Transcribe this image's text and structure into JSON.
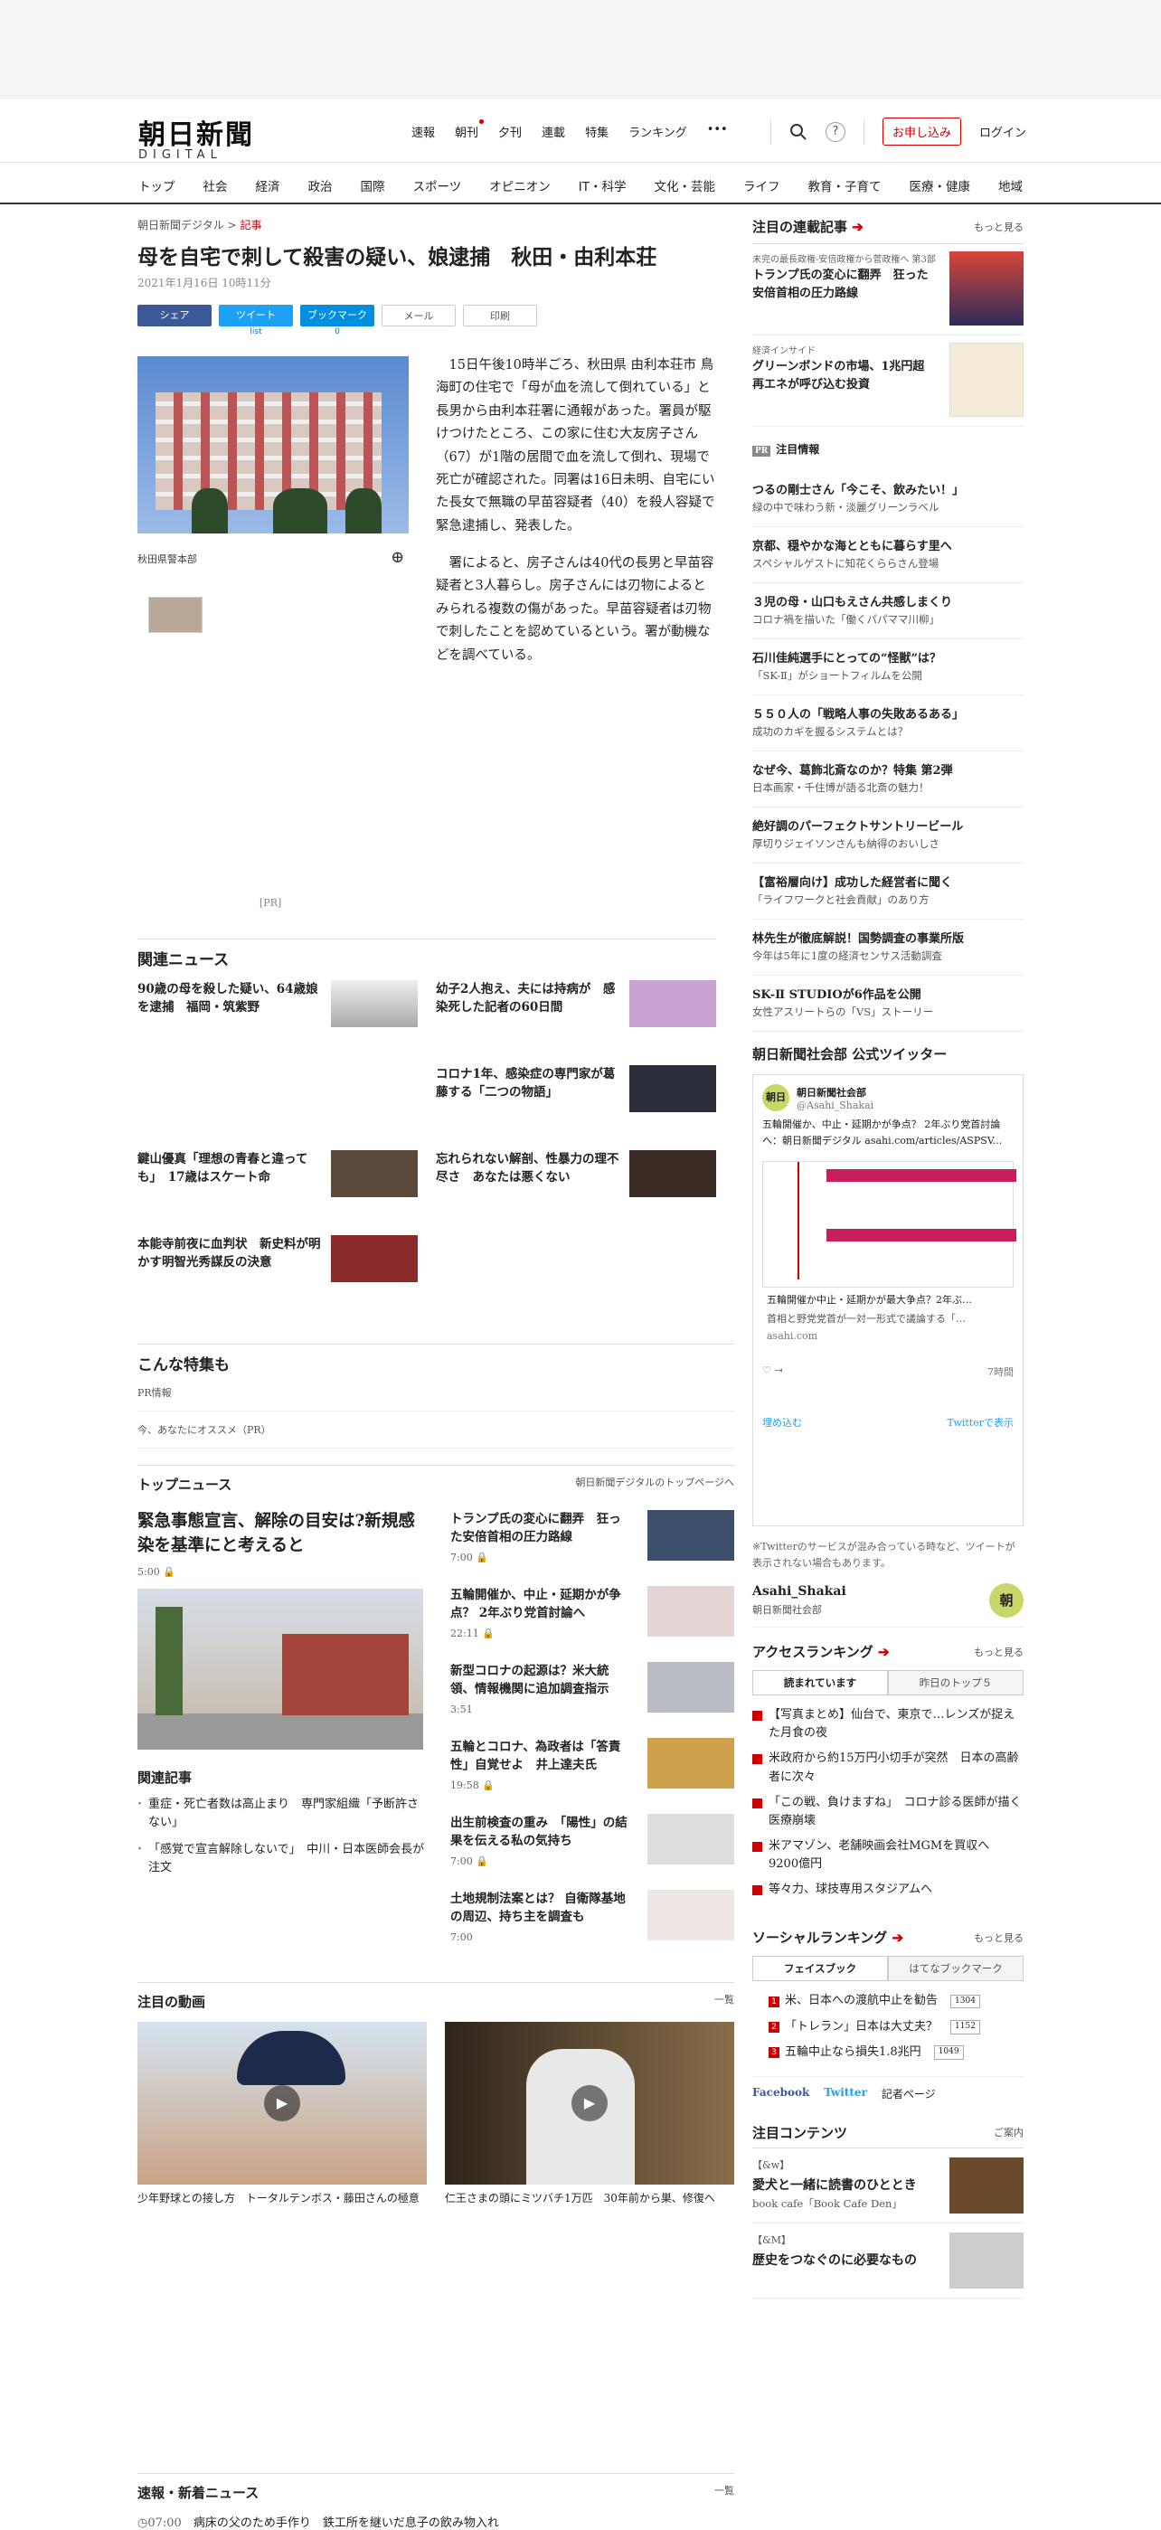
{
  "header": {
    "logo_ja": "朝日新聞",
    "logo_en": "DIGITAL",
    "nav": [
      "速報",
      "朝刊",
      "夕刊",
      "連載",
      "特集",
      "ランキング",
      "•••"
    ],
    "subscribe": "お申し込み",
    "login": "ログイン"
  },
  "gnav": [
    "トップ",
    "社会",
    "経済",
    "政治",
    "国際",
    "スポーツ",
    "オピニオン",
    "IT・科学",
    "文化・芸能",
    "ライフ",
    "教育・子育て",
    "医療・健康",
    "地域"
  ],
  "article": {
    "crumb_site": "朝日新聞デジタル",
    "crumb_sep": ">",
    "crumb_cat": "記事",
    "title": "母を自宅で刺して殺害の疑い、娘逮捕　秋田・由利本荘",
    "date": "2021年1月16日 10時11分",
    "share": {
      "fb": "シェア",
      "tw": "ツイート",
      "hb": "ブックマーク",
      "mail": "メール",
      "print": "印刷",
      "tw_count": "list",
      "hb_count": "0"
    },
    "caption": "秋田県警本部",
    "p1": "15日午後10時半ごろ、秋田県 由利本荘市 鳥海町の住宅で「母が血を流して倒れている」と長男から由利本荘署に通報があった。署員が駆けつけたところ、この家に住む大友房子さん（67）が1階の居間で血を流して倒れ、現場で死亡が確認された。同署は16日未明、自宅にいた長女で無職の早苗容疑者（40）を殺人容疑で緊急逮捕し、発表した。",
    "p2": "署によると、房子さんは40代の長男と早苗容疑者と3人暮らし。房子さんには刃物によるとみられる複数の傷があった。早苗容疑者は刃物で刺したことを認めているという。署が動機などを調べている。",
    "pr": "[PR]"
  },
  "related": {
    "title": "関連ニュース",
    "items": [
      "90歳の母を殺した疑い、64歳娘を逮捕　福岡・筑紫野",
      "幼子2人抱え、夫には持病が　感染死した記者の60日間",
      "",
      "コロナ1年、感染症の専門家が葛藤する「二つの物語」",
      "鍵山優真「理想の青春と違っても」　17歳はスケート命",
      "忘れられない解剖、性暴力の理不尽さ　あなたは悪くない",
      "本能寺前夜に血判状　新史料が明かす明智光秀謀反の決意",
      ""
    ]
  },
  "special": {
    "title": "こんな特集も",
    "rows": [
      "PR情報",
      "今、あなたにオススメ（PR）"
    ]
  },
  "topnews": {
    "title": "トップニュース",
    "more": "朝日新聞デジタルのトップページへ",
    "lead_title": "緊急事態宣言、解除の目安は?新規感染を基準にと考えると",
    "lead_time": "5:00",
    "related_title": "関連記事",
    "related": [
      "重症・死亡者数は高止まり　専門家組織「予断許さない」",
      "「感覚で宣言解除しないで」　中川・日本医師会長が注文"
    ],
    "items": [
      {
        "t": "トランプ氏の変心に翻弄　狂った安倍首相の圧力路線",
        "tm": "7:00"
      },
      {
        "t": "五輪開催か、中止・延期かが争点？ 2年ぶり党首討論へ",
        "tm": "22:11"
      },
      {
        "t": "新型コロナの起源は？米大統領、情報機関に追加調査指示",
        "tm": "3:51"
      },
      {
        "t": "五輪とコロナ、為政者は「答責性」自覚せよ　井上達夫氏",
        "tm": "19:58"
      },
      {
        "t": "出生前検査の重み　「陽性」の結果を伝える私の気持ち",
        "tm": "7:00"
      },
      {
        "t": "土地規制法案とは？ 自衛隊基地の周辺、持ち主を調査も",
        "tm": "7:00"
      }
    ]
  },
  "videos": {
    "title": "注目の動画",
    "more": "一覧",
    "items": [
      "少年野球との接し方　トータルテンボス・藤田さんの極意",
      "仁王さまの頭にミツバチ1万匹　30年前から巣、修復へ"
    ]
  },
  "flash": {
    "title": "速報・新着ニュース",
    "more": "一覧",
    "time": "07:00",
    "text": "病床の父のため手作り　鉄工所を継いだ息子の飲み物入れ"
  },
  "side": {
    "rensai_title": "注目の連載記事",
    "more": "もっと見る",
    "feat": [
      {
        "k": "未完の最長政権-安倍政権から菅政権へ 第3部",
        "t": "トランプ氏の変心に翻弄　狂った安倍首相の圧力路線"
      },
      {
        "k": "経済インサイド",
        "t": "グリーンボンドの市場、1兆円超　再エネが呼び込む投資"
      }
    ],
    "pr_label": "PR",
    "pr_title": "注目情報",
    "pr": [
      {
        "a": "つるの剛士さん「今こそ、飲みたい！」",
        "b": "緑の中で味わう新・淡麗グリーンラベル"
      },
      {
        "a": "京都、穏やかな海とともに暮らす里へ",
        "b": "スペシャルゲストに知花くららさん登場"
      },
      {
        "a": "３児の母・山口もえさん共感しまくり",
        "b": "コロナ禍を描いた「働くパパママ川柳」"
      },
      {
        "a": "石川佳純選手にとっての“怪獣”は？",
        "b": "「SK-Ⅱ」がショートフィルムを公開"
      },
      {
        "a": "５５０人の「戦略人事の失敗あるある」",
        "b": "成功のカギを握るシステムとは？"
      },
      {
        "a": "なぜ今、葛飾北斎なのか？特集 第2弾",
        "b": "日本画家・千住博が語る北斎の魅力！"
      },
      {
        "a": "絶好調のパーフェクトサントリービール",
        "b": "厚切りジェイソンさんも納得のおいしさ"
      },
      {
        "a": "【富裕層向け】成功した経営者に聞く",
        "b": "「ライフワークと社会貢献」のあり方"
      },
      {
        "a": "林先生が徹底解説！国勢調査の事業所版",
        "b": "今年は5年に1度の経済センサス活動調査"
      },
      {
        "a": "SK-Ⅱ STUDIOが6作品を公開",
        "b": "女性アスリートらの「VS」ストーリー"
      }
    ],
    "tw_title": "朝日新聞社会部 公式ツイッター",
    "tw": {
      "name": "朝日新聞社会部",
      "id": "@Asahi_Shakai",
      "text": "五輪開催か、中止・延期かが争点？ 2年ぶり党首討論へ：朝日新聞デジタル asahi.com/articles/ASPSV...",
      "card": "五輪開催か中止・延期かが最大争点？2年ぶ…",
      "card2": "首相と野党党首が一対一形式で議論する「…",
      "domain": "asahi.com",
      "age": "7時間",
      "embed": "埋め込む",
      "view": "Twitterで表示",
      "note": "※Twitterのサービスが混み合っている時など、ツイートが表示されない場合もあります。",
      "acct": "Asahi_Shakai",
      "acct_sub": "朝日新聞社会部",
      "circle": "朝"
    },
    "access_title": "アクセスランキング",
    "access_tabs": [
      "読まれています",
      "昨日のトップ５"
    ],
    "access": [
      "【写真まとめ】仙台で、東京で…レンズが捉えた月食の夜",
      "米政府から約15万円小切手が突然　日本の高齢者に次々",
      "「この戦、負けますね」　コロナ診る医師が描く医療崩壊",
      "米アマゾン、老舗映画会社MGMを買収へ　9200億円",
      "等々力、球技専用スタジアムへ"
    ],
    "social_title": "ソーシャルランキング",
    "social_tabs": [
      "フェイスブック",
      "はてなブックマーク"
    ],
    "social": [
      {
        "t": "米、日本への渡航中止を勧告",
        "c": "1304"
      },
      {
        "t": "「トレラン」日本は大丈夫？",
        "c": "1152"
      },
      {
        "t": "五輪中止なら損失1.8兆円",
        "c": "1049"
      }
    ],
    "links": [
      "Facebook",
      "Twitter",
      "記者ページ"
    ],
    "content_title": "注目コンテンツ",
    "content_more": "ご案内",
    "contents": [
      {
        "k": "【&w】",
        "h": "愛犬と一緒に読書のひととき",
        "s": "book cafe「Book Cafe Den」"
      },
      {
        "k": "【&M】",
        "h": "歴史をつなぐのに必要なもの",
        "s": ""
      }
    ]
  },
  "colors": {
    "accent": "#c00",
    "twitter": "#1da1f2",
    "facebook": "#3b5998"
  }
}
